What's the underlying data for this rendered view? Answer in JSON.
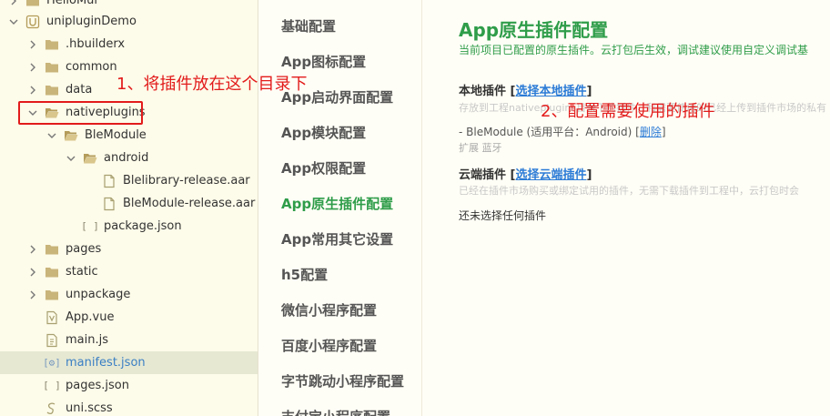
{
  "tree": {
    "items": [
      {
        "label": "HelloMui",
        "icon": "folder-icon"
      },
      {
        "label": "unipluginDemo",
        "icon": "project-icon"
      },
      {
        "label": ".hbuilderx",
        "icon": "folder-icon"
      },
      {
        "label": "common",
        "icon": "folder-icon"
      },
      {
        "label": "data",
        "icon": "folder-icon"
      },
      {
        "label": "nativeplugins",
        "icon": "folder-open-icon"
      },
      {
        "label": "BleModule",
        "icon": "folder-open-icon"
      },
      {
        "label": "android",
        "icon": "folder-open-icon"
      },
      {
        "label": "Blelibrary-release.aar",
        "icon": "file-icon"
      },
      {
        "label": "BleModule-release.aar",
        "icon": "file-icon"
      },
      {
        "label": "package.json",
        "icon": "json-icon"
      },
      {
        "label": "pages",
        "icon": "folder-icon"
      },
      {
        "label": "static",
        "icon": "folder-icon"
      },
      {
        "label": "unpackage",
        "icon": "folder-icon"
      },
      {
        "label": "App.vue",
        "icon": "vue-file-icon"
      },
      {
        "label": "main.js",
        "icon": "js-file-icon"
      },
      {
        "label": "manifest.json",
        "icon": "settings-json-icon",
        "selected": true
      },
      {
        "label": "pages.json",
        "icon": "json-icon"
      },
      {
        "label": "uni.scss",
        "icon": "scss-file-icon"
      }
    ]
  },
  "nav": {
    "items": [
      {
        "label": "基础配置"
      },
      {
        "label": "App图标配置"
      },
      {
        "label": "App启动界面配置"
      },
      {
        "label": "App模块配置"
      },
      {
        "label": "App权限配置"
      },
      {
        "label": "App原生插件配置",
        "active": true
      },
      {
        "label": "App常用其它设置"
      },
      {
        "label": "h5配置"
      },
      {
        "label": "微信小程序配置"
      },
      {
        "label": "百度小程序配置"
      },
      {
        "label": "字节跳动小程序配置"
      },
      {
        "label": "支付宝小程序配置"
      }
    ]
  },
  "content": {
    "title": "App原生插件配置",
    "subtitle": "当前项目已配置的原生插件。云打包后生效，调试建议使用自定义调试基",
    "local": {
      "title": "本地插件",
      "link": "选择本地插件",
      "hint": "存放到工程nativeplugins目录下的插件，和需要使用的已经上传到插件市场的私有",
      "plugin_prefix": "- BleModule (适用平台：Android)",
      "delete_label": "删除",
      "tag": "扩展 蓝牙"
    },
    "cloud": {
      "title": "云端插件",
      "link": "选择云端插件",
      "hint": "已经在插件市场购买或绑定试用的插件，无需下载插件到工程中，云打包时会",
      "empty": "还未选择任何插件"
    }
  },
  "annotations": {
    "step1": "1、将插件放在这个目录下",
    "step2": "2、配置需要使用的插件"
  },
  "colors": {
    "accent_green": "#2f9d4a",
    "link_blue": "#2b7bd6",
    "annotation_red": "#e21b1b",
    "selected_row": "#e6e8d2"
  }
}
